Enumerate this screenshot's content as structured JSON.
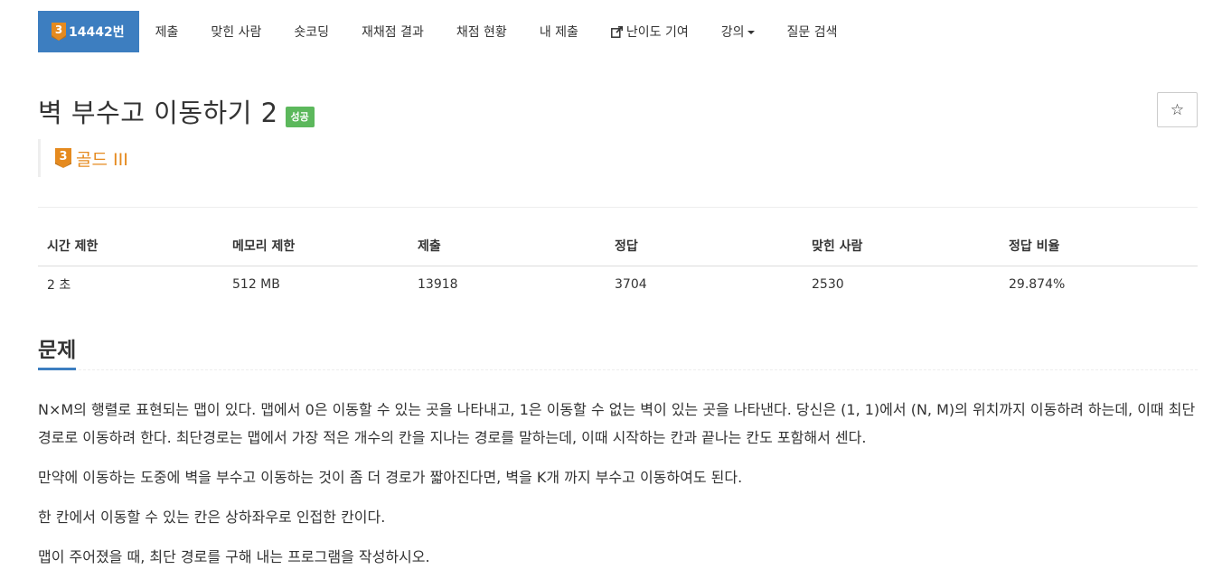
{
  "colors": {
    "nav_active": "#3d7ec0",
    "tier_gold": "#e58a1f",
    "success": "#5cb85c"
  },
  "nav": {
    "problem_tier_level": "3",
    "problem_id_label": "14442번",
    "items": [
      "제출",
      "맞힌 사람",
      "숏코딩",
      "재채점 결과",
      "채점 현황",
      "내 제출"
    ],
    "difficulty_contrib_label": "난이도 기여",
    "lecture_label": "강의",
    "question_search_label": "질문 검색",
    "icons": {
      "external_link": "external-link-icon",
      "dropdown": "caret-down-icon"
    }
  },
  "problem": {
    "title": "벽 부수고 이동하기 2",
    "status_label": "성공",
    "star_glyph": "☆",
    "tier_level": "3",
    "tier_name": "골드 III"
  },
  "stats": {
    "headers": [
      "시간 제한",
      "메모리 제한",
      "제출",
      "정답",
      "맞힌 사람",
      "정답 비율"
    ],
    "values": [
      "2 초",
      "512 MB",
      "13918",
      "3704",
      "2530",
      "29.874%"
    ]
  },
  "section": {
    "title": "문제"
  },
  "description": {
    "paragraphs": [
      "N×M의 행렬로 표현되는 맵이 있다. 맵에서 0은 이동할 수 있는 곳을 나타내고, 1은 이동할 수 없는 벽이 있는 곳을 나타낸다. 당신은 (1, 1)에서 (N, M)의 위치까지 이동하려 하는데, 이때 최단 경로로 이동하려 한다. 최단경로는 맵에서 가장 적은 개수의 칸을 지나는 경로를 말하는데, 이때 시작하는 칸과 끝나는 칸도 포함해서 센다.",
      "만약에 이동하는 도중에 벽을 부수고 이동하는 것이 좀 더 경로가 짧아진다면, 벽을 K개 까지 부수고 이동하여도 된다.",
      "한 칸에서 이동할 수 있는 칸은 상하좌우로 인접한 칸이다.",
      "맵이 주어졌을 때, 최단 경로를 구해 내는 프로그램을 작성하시오."
    ]
  }
}
